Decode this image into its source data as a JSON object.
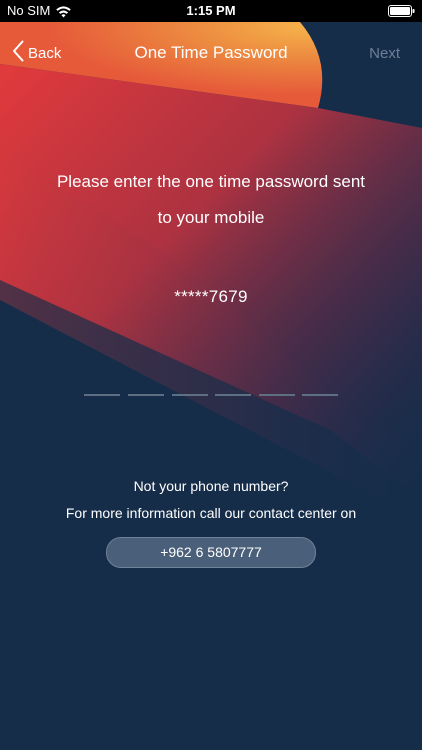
{
  "status_bar": {
    "carrier": "No SIM",
    "time": "1:15 PM"
  },
  "nav": {
    "back_label": "Back",
    "title": "One Time Password",
    "next_label": "Next"
  },
  "prompt": {
    "line1": "Please enter the one time password sent",
    "line2": "to your mobile"
  },
  "masked_number": "*****7679",
  "otp": {
    "digit_count": 6,
    "digits": [
      "",
      "",
      "",
      "",
      "",
      ""
    ]
  },
  "help": {
    "question": "Not your phone number?",
    "info": "For more information call our contact center on",
    "phone": "+962 6 5807777"
  },
  "colors": {
    "background": "#162d4a",
    "accent_orange": "#f2a444",
    "accent_red": "#e8413a",
    "next_disabled": "#6d7f95",
    "button_fill": "#4a5f79"
  }
}
